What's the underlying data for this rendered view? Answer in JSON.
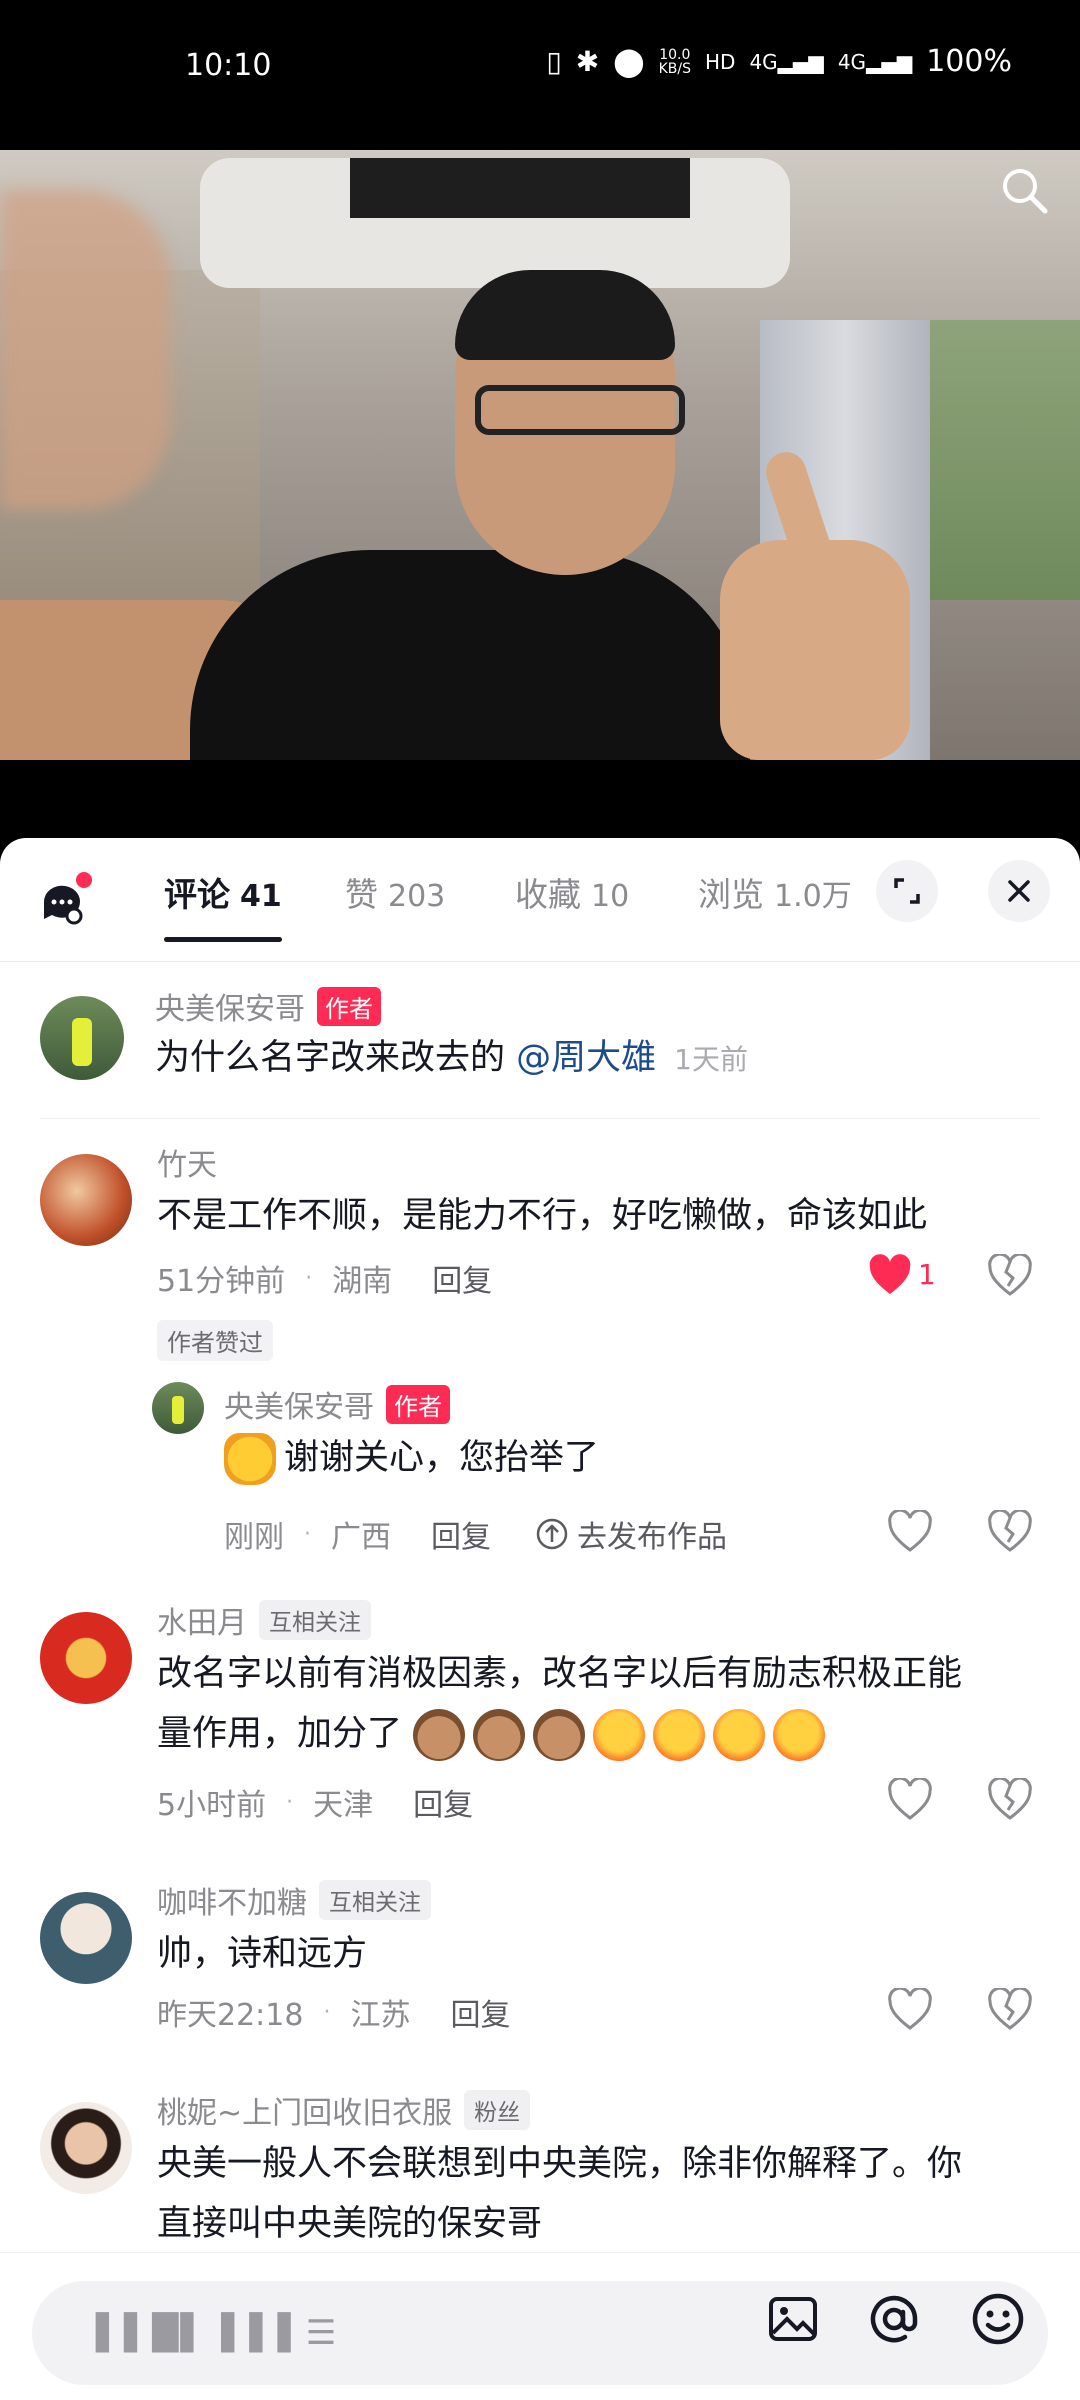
{
  "status_bar": {
    "time": "10:10",
    "net_speed_value": "10.0",
    "net_speed_unit": "KB/S",
    "hd_label": "HD",
    "signal1": "4G",
    "signal2": "4G",
    "battery": "100%"
  },
  "video": {
    "search_icon": "search-icon"
  },
  "tabs": {
    "comments_label": "评论",
    "comments_count": "41",
    "likes_label": "赞",
    "likes_count": "203",
    "favorites_label": "收藏",
    "favorites_count": "10",
    "views_label": "浏览",
    "views_count": "1.0万"
  },
  "comments": [
    {
      "user": "央美保安哥",
      "badge": "作者",
      "text": "为什么名字改来改去的 ",
      "mention": "@周大雄",
      "time": "1天前"
    },
    {
      "user": "竹天",
      "text": "不是工作不顺，是能力不行，好吃懒做，命该如此",
      "time": "51分钟前",
      "location": "湖南",
      "reply": "回复",
      "likes": "1",
      "author_liked": "作者赞过",
      "sub_reply": {
        "user": "央美保安哥",
        "badge": "作者",
        "text": "谢谢关心，您抬举了",
        "time": "刚刚",
        "location": "广西",
        "reply": "回复",
        "publish": "去发布作品"
      }
    },
    {
      "user": "水田月",
      "badge": "互相关注",
      "text_line1": "改名字以前有消极因素，改名字以后有励志积极正能",
      "text_line2": "量作用，加分了",
      "time": "5小时前",
      "location": "天津",
      "reply": "回复"
    },
    {
      "user": "咖啡不加糖",
      "badge": "互相关注",
      "text": "帅，诗和远方",
      "time": "昨天22:18",
      "location": "江苏",
      "reply": "回复"
    },
    {
      "user": "桃妮~上门回收旧衣服",
      "badge": "粉丝",
      "text_line1": "央美一般人不会联想到中央美院，除非你解释了。你",
      "text_line2": "直接叫中央美院的保安哥"
    }
  ],
  "bottom_bar": {
    "placeholder": "▌▌█▌ ▌▌▌☰"
  },
  "colors": {
    "accent": "#fe2c55",
    "text": "#161823",
    "muted": "#8a8a8f",
    "mention": "#1d4c8c"
  }
}
